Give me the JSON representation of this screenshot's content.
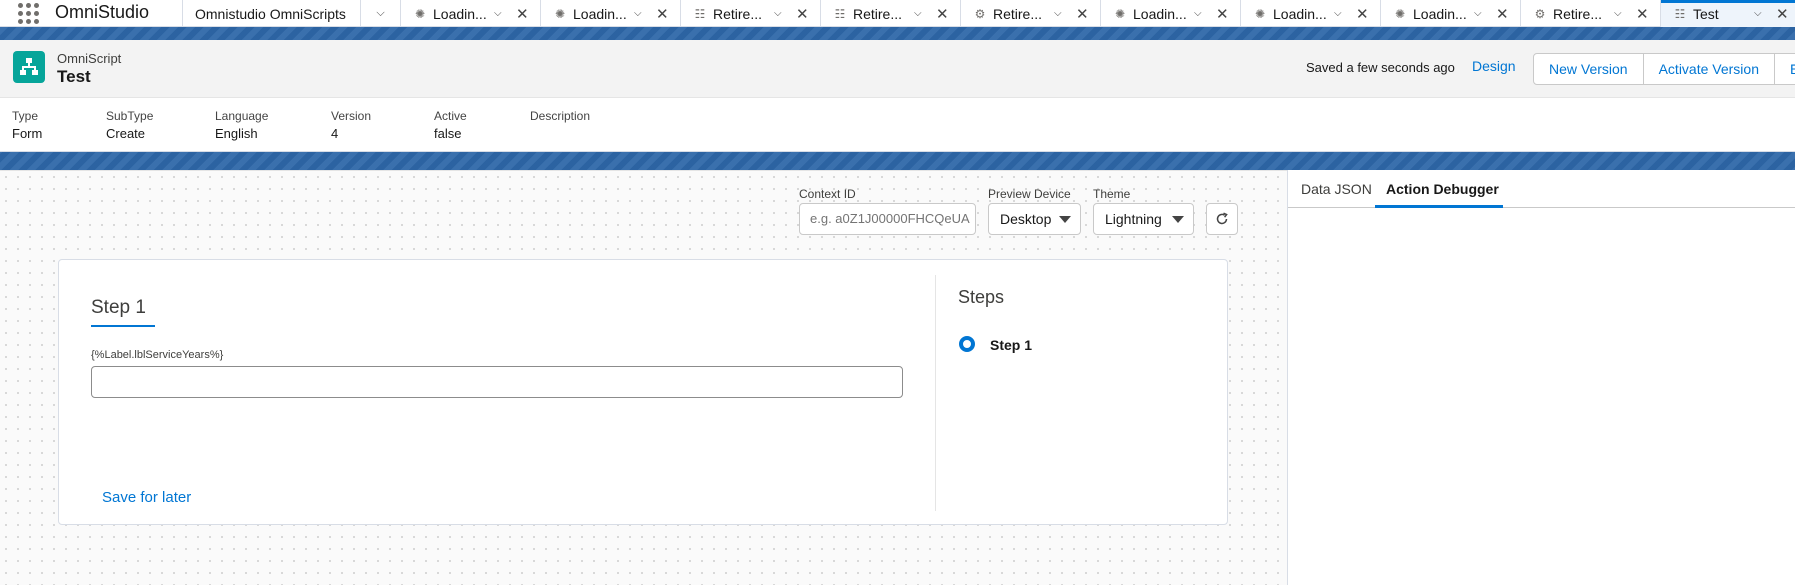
{
  "app": {
    "name": "OmniStudio"
  },
  "tabs": [
    {
      "label": "Omnistudio OmniScripts",
      "icon": "",
      "type": "nav"
    },
    {
      "label": "",
      "icon": "chevron-down-icon",
      "type": "chevron"
    },
    {
      "label": "Loadin...",
      "icon": "loading-icon",
      "type": "record"
    },
    {
      "label": "Loadin...",
      "icon": "loading-icon",
      "type": "record"
    },
    {
      "label": "Retire...",
      "icon": "omniscript-icon",
      "type": "record"
    },
    {
      "label": "Retire...",
      "icon": "omniscript-icon",
      "type": "record"
    },
    {
      "label": "Retire...",
      "icon": "integration-icon",
      "type": "record"
    },
    {
      "label": "Loadin...",
      "icon": "loading-icon",
      "type": "record"
    },
    {
      "label": "Loadin...",
      "icon": "loading-icon",
      "type": "record"
    },
    {
      "label": "Loadin...",
      "icon": "loading-icon",
      "type": "record"
    },
    {
      "label": "Retire...",
      "icon": "integration-icon",
      "type": "record"
    },
    {
      "label": "Test",
      "icon": "omniscript-icon",
      "type": "record",
      "active": true
    }
  ],
  "header": {
    "object_type": "OmniScript",
    "title": "Test",
    "saved_status": "Saved a few seconds ago",
    "design_label": "Design",
    "buttons": [
      "New Version",
      "Activate Version",
      "Edi"
    ],
    "fields": [
      {
        "label": "Type",
        "value": "Form"
      },
      {
        "label": "SubType",
        "value": "Create"
      },
      {
        "label": "Language",
        "value": "English"
      },
      {
        "label": "Version",
        "value": "4"
      },
      {
        "label": "Active",
        "value": "false"
      },
      {
        "label": "Description",
        "value": ""
      }
    ]
  },
  "controls": {
    "context_id_label": "Context ID",
    "context_id_placeholder": "e.g. a0Z1J00000FHCQeUA",
    "preview_device_label": "Preview Device",
    "preview_device_value": "Desktop",
    "theme_label": "Theme",
    "theme_value": "Lightning"
  },
  "preview": {
    "step_title": "Step 1",
    "input_label": "{%Label.lblServiceYears%}",
    "input_value": "",
    "save_for_later": "Save for later",
    "steps_heading": "Steps",
    "steps": [
      "Step 1"
    ]
  },
  "right_panel": {
    "tabs": [
      "Data JSON",
      "Action Debugger"
    ],
    "active_tab": "Action Debugger"
  },
  "colors": {
    "brand_blue": "#0176d3",
    "band_blue": "#2e67a8",
    "object_icon": "#06a59a"
  }
}
